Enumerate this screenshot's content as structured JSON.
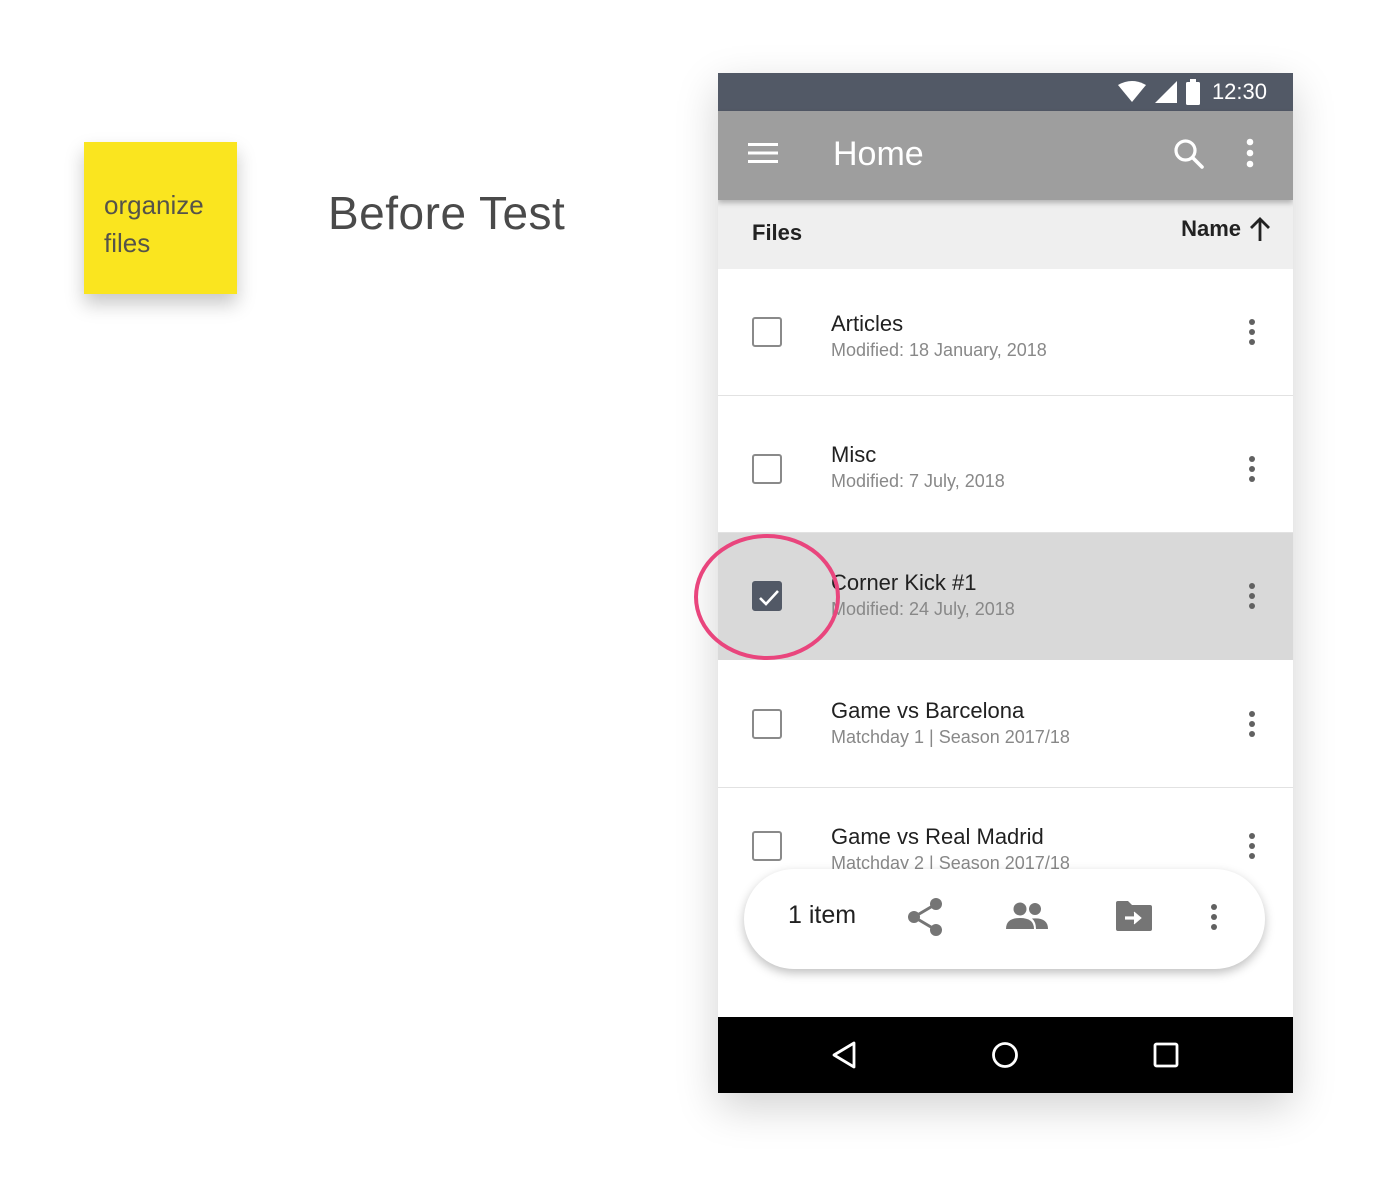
{
  "note": {
    "lines": [
      "organize",
      "files"
    ],
    "color": "#fae51f"
  },
  "heading": "Before Test",
  "phone": {
    "status_bar": {
      "time": "12:30",
      "background": "#525966"
    },
    "app_bar": {
      "title": "Home",
      "background": "#9e9e9e",
      "icons": [
        "menu-icon",
        "search-icon",
        "more-vert-icon"
      ]
    },
    "list_header": {
      "left_label": "Files",
      "sort_label": "Name",
      "sort_icon": "arrow-up-icon"
    },
    "rows": [
      {
        "name": "Articles",
        "meta": "Modified: 18 January, 2018",
        "checked": false
      },
      {
        "name": "Misc",
        "meta": "Modified: 7 July, 2018",
        "checked": false
      },
      {
        "name": "Corner Kick #1",
        "meta": "Modified: 24 July, 2018",
        "checked": true
      },
      {
        "name": "Game vs Barcelona",
        "meta": "Matchday 1 | Season 2017/18",
        "checked": false
      },
      {
        "name": "Game vs Real Madrid",
        "meta": "Matchday 2 | Season 2017/18",
        "checked": false
      }
    ],
    "selection_bar": {
      "count_label": "1 item",
      "icons": [
        "share-icon",
        "people-icon",
        "move-to-folder-icon",
        "more-vert-icon"
      ]
    },
    "nav_bar": {
      "icons": [
        "back-icon",
        "home-icon",
        "recents-icon"
      ]
    }
  },
  "colors": {
    "highlight": "#e9457d",
    "selected_row": "#d9d9d9"
  }
}
